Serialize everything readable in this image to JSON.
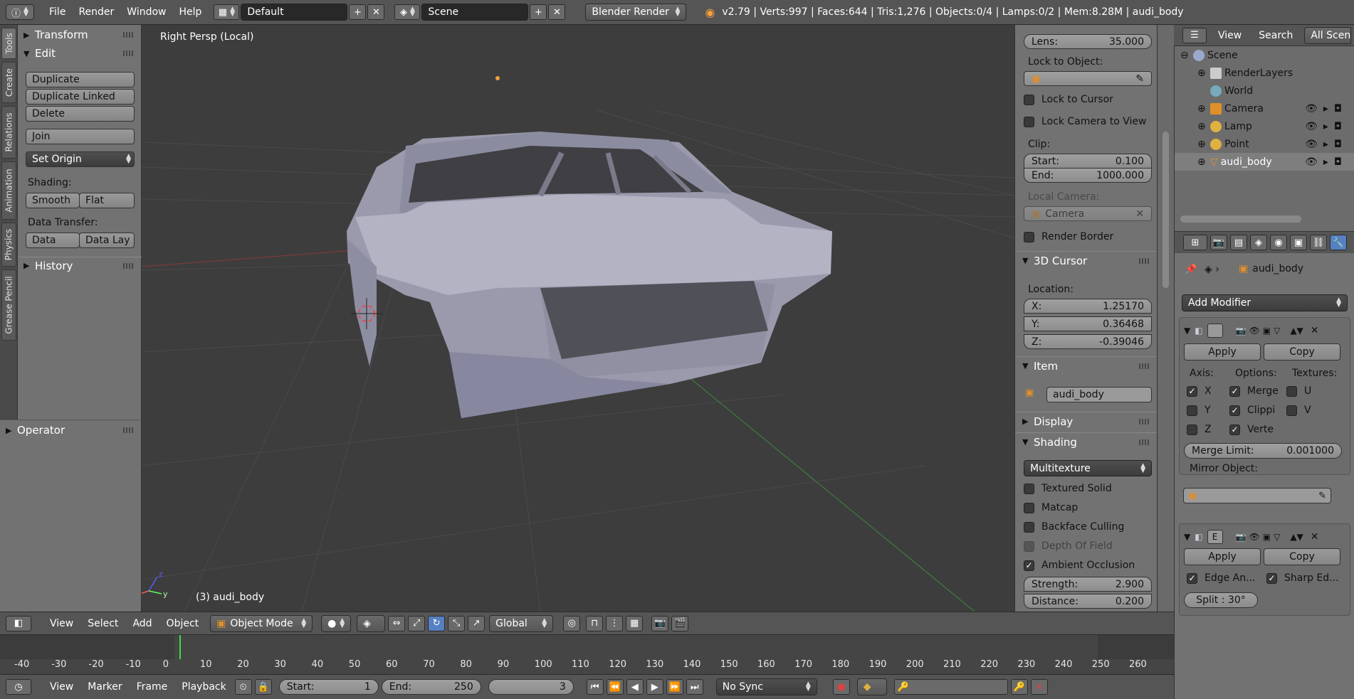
{
  "topbar": {
    "menus": [
      "File",
      "Render",
      "Window",
      "Help"
    ],
    "layout": "Default",
    "scene": "Scene",
    "engine": "Blender Render",
    "stats": "v2.79 | Verts:997 | Faces:644 | Tris:1,276 | Objects:0/4 | Lamps:0/2 | Mem:8.28M | audi_body"
  },
  "tool_tabs": [
    "Tools",
    "Create",
    "Relations",
    "Animation",
    "Physics",
    "Grease Pencil"
  ],
  "tool_shelf": {
    "transform": "Transform",
    "edit": "Edit",
    "duplicate": "Duplicate",
    "duplicate_linked": "Duplicate Linked",
    "delete": "Delete",
    "join": "Join",
    "set_origin": "Set Origin",
    "shading_label": "Shading:",
    "smooth": "Smooth",
    "flat": "Flat",
    "data_transfer_label": "Data Transfer:",
    "data": "Data",
    "data_lay": "Data Lay",
    "history": "History",
    "operator": "Operator"
  },
  "viewport": {
    "view_name": "Right Persp (Local)",
    "object_label": "(3) audi_body"
  },
  "npanel": {
    "lens_label": "Lens:",
    "lens_value": "35.000",
    "lock_to_object": "Lock to Object:",
    "lock_to_cursor": "Lock to Cursor",
    "lock_camera_to_view": "Lock Camera to View",
    "clip": "Clip:",
    "start_label": "Start:",
    "start_value": "0.100",
    "end_label": "End:",
    "end_value": "1000.000",
    "local_camera": "Local Camera:",
    "camera_placeholder": "Camera",
    "render_border": "Render Border",
    "cursor_header": "3D Cursor",
    "location": "Location:",
    "x_label": "X:",
    "x_value": "1.25170",
    "y_label": "Y:",
    "y_value": "0.36468",
    "z_label": "Z:",
    "z_value": "-0.39046",
    "item_header": "Item",
    "item_name": "audi_body",
    "display_header": "Display",
    "shading_header": "Shading",
    "shading_mode": "Multitexture",
    "textured_solid": "Textured Solid",
    "matcap": "Matcap",
    "backface_culling": "Backface Culling",
    "depth_of_field": "Depth Of Field",
    "ambient_occlusion": "Ambient Occlusion",
    "strength_label": "Strength:",
    "strength_value": "2.900",
    "distance_label": "Distance:",
    "distance_value": "0.200"
  },
  "outliner": {
    "view": "View",
    "search": "Search",
    "all_scenes": "All Scenes",
    "items": [
      "Scene",
      "RenderLayers",
      "World",
      "Camera",
      "Lamp",
      "Point",
      "audi_body"
    ]
  },
  "properties": {
    "object_name": "audi_body",
    "add_modifier": "Add Modifier",
    "apply": "Apply",
    "copy": "Copy",
    "axis_label": "Axis:",
    "options_label": "Options:",
    "textures_label": "Textures:",
    "axis_x": "X",
    "axis_y": "Y",
    "axis_z": "Z",
    "merge": "Merge",
    "clipping": "Clippi",
    "vertex": "Verte",
    "tex_u": "U",
    "tex_v": "V",
    "merge_limit_label": "Merge Limit:",
    "merge_limit_value": "0.001000",
    "mirror_object": "Mirror Object:",
    "mod2_letter": "E",
    "edge_angle": "Edge An...",
    "sharp_edges": "Sharp Ed...",
    "split": "Split : 30°"
  },
  "viewport_header": {
    "menus": [
      "View",
      "Select",
      "Add",
      "Object"
    ],
    "mode": "Object Mode",
    "orientation": "Global"
  },
  "timeline": {
    "ticks": [
      "-40",
      "-30",
      "-20",
      "-10",
      "0",
      "10",
      "20",
      "30",
      "40",
      "50",
      "60",
      "70",
      "80",
      "90",
      "100",
      "110",
      "120",
      "130",
      "140",
      "150",
      "160",
      "170",
      "180",
      "190",
      "200",
      "210",
      "220",
      "230",
      "240",
      "250",
      "260"
    ],
    "current_frame": 3
  },
  "timeline_header": {
    "menus": [
      "View",
      "Marker",
      "Frame",
      "Playback"
    ],
    "start_label": "Start:",
    "start_value": "1",
    "end_label": "End:",
    "end_value": "250",
    "current": "3",
    "sync": "No Sync"
  }
}
